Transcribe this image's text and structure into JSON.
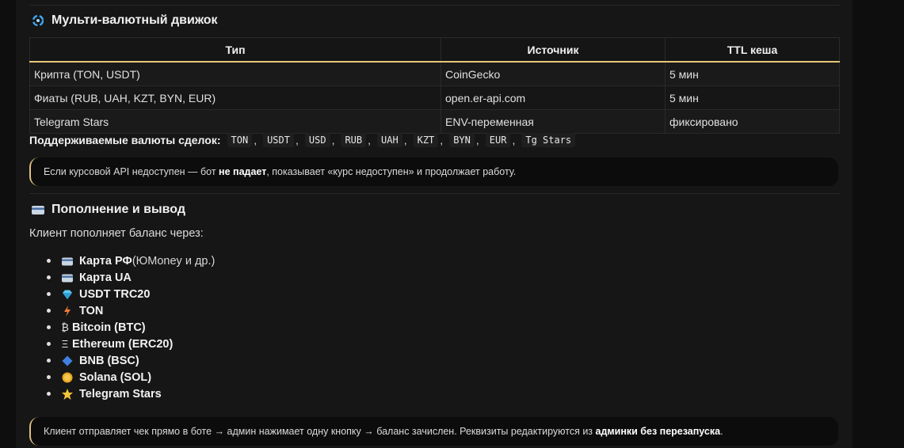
{
  "engine": {
    "title": "Мульти-валютный движок",
    "table": {
      "headers": [
        "Тип",
        "Источник",
        "TTL кеша"
      ],
      "rows": [
        [
          "Крипта (TON, USDT)",
          "CoinGecko",
          "5 мин"
        ],
        [
          "Фиаты (RUB, UAH, KZT, BYN, EUR)",
          "open.er-api.com",
          "5 мин"
        ],
        [
          "Telegram Stars",
          "ENV-переменная",
          "фиксировано"
        ]
      ]
    },
    "currencies_label": "Поддерживаемые валюты сделок:",
    "currencies": [
      "TON",
      "USDT",
      "USD",
      "RUB",
      "UAH",
      "KZT",
      "BYN",
      "EUR",
      "Tg Stars"
    ],
    "note": {
      "before": "Если курсовой API недоступен — бот ",
      "bold": "не падает",
      "after": ", показывает «курс недоступен» и продолжает работу."
    }
  },
  "payments": {
    "title": "Пополнение и вывод",
    "intro": "Клиент пополняет баланс через:",
    "methods": [
      {
        "icon": "card-icon",
        "bold": "Карта РФ",
        "rest": " (ЮMoney и др.)"
      },
      {
        "icon": "card-icon",
        "bold": "Карта UA",
        "rest": ""
      },
      {
        "icon": "diamond-icon",
        "bold": "USDT TRC20",
        "rest": ""
      },
      {
        "icon": "lightning-icon",
        "bold": "TON",
        "rest": ""
      },
      {
        "icon": "bitcoin-icon",
        "bold": "Bitcoin (BTC)",
        "rest": ""
      },
      {
        "icon": "ethereum-icon",
        "bold": "Ethereum (ERC20)",
        "rest": ""
      },
      {
        "icon": "blue-diamond-icon",
        "bold": "BNB (BSC)",
        "rest": ""
      },
      {
        "icon": "sun-icon",
        "bold": "Solana (SOL)",
        "rest": ""
      },
      {
        "icon": "star-icon",
        "bold": "Telegram Stars",
        "rest": ""
      }
    ],
    "note": {
      "before": "Клиент отправляет чек прямо в боте → админ нажимает одну кнопку → баланс зачислен. Реквизиты редактируются из ",
      "bold": "админки без перезапуска",
      "after": "."
    }
  },
  "colors": {
    "accent": "#e8c77a",
    "background": "#161616",
    "note_bg": "#0c0c0c"
  }
}
